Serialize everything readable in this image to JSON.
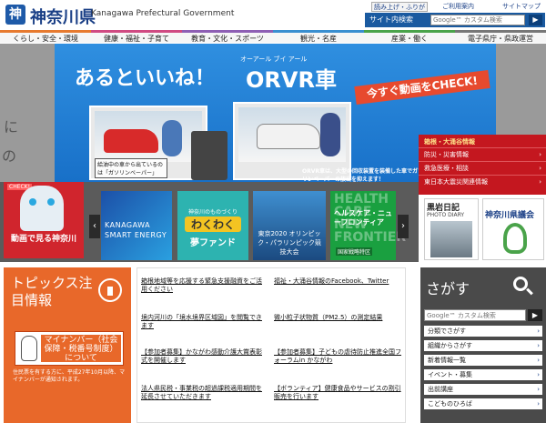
{
  "header": {
    "logo_mark": "神",
    "logo_text": "神奈川県",
    "logo_sub": "Kanagawa Prefectural Government",
    "read_button": "読み上げ・ふりがな",
    "mail_link": "ご利用案内",
    "sitemap_link": "サイトマップ",
    "search_label": "サイト内検索",
    "search_placeholder": "Google™ カスタム検索",
    "search_go": "▶"
  },
  "nav": {
    "items": [
      "くらし・安全・環境",
      "健康・福祉・子育て",
      "教育・文化・スポーツ",
      "観光・名産",
      "産業・働く",
      "電子県庁・県政運営"
    ]
  },
  "side_left": {
    "text1": "に",
    "text2": "の"
  },
  "banner": {
    "title": "あるといいね！",
    "ruby": "オーアール ブイ アール",
    "orvr": "ORVR車",
    "cta": "今すぐ動画をCHECK!",
    "caption1": "給油中の車から出ているのは「ガソリンベーパー」",
    "caption2": "ORVR車は、大型の回収装置を装備した車でガソリンベーパーの放出を抑えます！"
  },
  "red_side": {
    "title": "箱根・大涌谷情報",
    "items": [
      "防災・災害情報",
      "救急医療・相談",
      "東日本大震災関連情報"
    ],
    "arrow": "›"
  },
  "thumbs": {
    "check_badge": "CHECK!",
    "red_label": "動画で見る神奈川",
    "left_arrow": "‹",
    "right_arrow": "›",
    "kanagawa": "KANAGAWA SMART ENERGY",
    "waku_small": "神奈川のものづくり",
    "waku_big": "わくわく",
    "waku_yume": "夢ファンド",
    "oly": "東京2020 オリンピック・パラリンピック競技大会",
    "health_bg": "HEALTH CARE NEW FRONTIER",
    "health_text": "ヘルスケア・ニューフロンティア",
    "health_sub": "国家戦略特区"
  },
  "diary": {
    "title": "黒岩日記",
    "sub": "PHOTO DIARY"
  },
  "assembly": {
    "title": "神奈川県議会"
  },
  "topics": {
    "title": "トピックス注目情報",
    "myna_text": "マイナンバー（社会保障・税番号制度）について",
    "note": "住民票を有する方に、平成27年10月以降、マイナンバーが通知されます。"
  },
  "topics_list": [
    "箱根地域等を応援する緊急支援融資をご活用ください",
    "福祉・大涌谷情報のFacebook、Twitter",
    "境内河川の「境水境界区域図」を閲覧できます",
    "微小粒子状物質（PM2.5）の測定結果",
    "【参加者募集】かながわ感動介護大賞表彰式を開催します",
    "【参加者募集】子どもの虐待防止推進全国フォーラムin かながわ",
    "法人県民税・事業税の超過課税適用期間を延長させていただきます",
    "【ボランティア】健康食品やサービスの割引販売を行います"
  ],
  "sagasu": {
    "title": "さがす",
    "placeholder": "Google™ カスタム検索",
    "go": "▶",
    "items": [
      "分類でさがす",
      "組織からさがす",
      "新着情報一覧",
      "イベント・募集",
      "出前講座",
      "こどものひろば"
    ],
    "arrow": "›"
  },
  "colors": {
    "brand_blue": "#1a3f86",
    "topics_orange": "#e8682a",
    "alert_red": "#c4171f"
  }
}
